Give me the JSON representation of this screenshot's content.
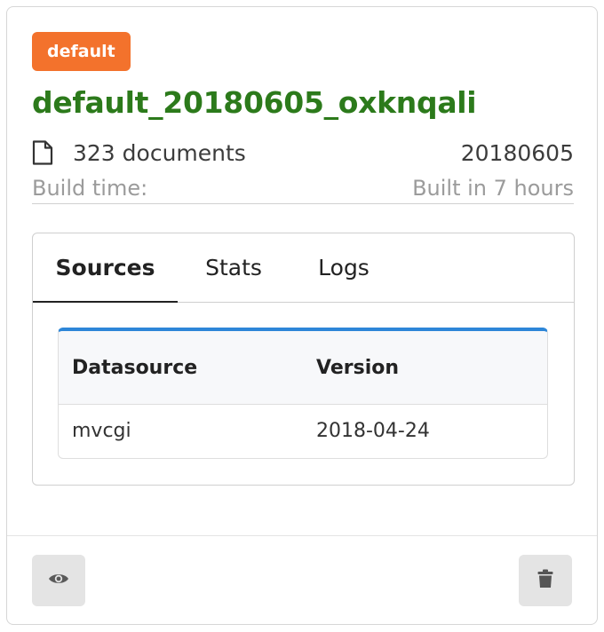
{
  "card": {
    "badge": "default",
    "title": "default_20180605_oxknqali",
    "documents": "323 documents",
    "date": "20180605",
    "build_label": "Build time:",
    "build_value": "Built in 7 hours"
  },
  "tabs": [
    {
      "label": "Sources",
      "active": true
    },
    {
      "label": "Stats",
      "active": false
    },
    {
      "label": "Logs",
      "active": false
    }
  ],
  "sources_table": {
    "headers": [
      "Datasource",
      "Version"
    ],
    "rows": [
      [
        "mvcgi",
        "2018-04-24"
      ]
    ]
  },
  "footer": {
    "view_icon": "eye-icon",
    "delete_icon": "trash-icon"
  },
  "colors": {
    "badge": "#f3722c",
    "title": "#2c7a1b",
    "table_accent": "#2d86d8"
  }
}
